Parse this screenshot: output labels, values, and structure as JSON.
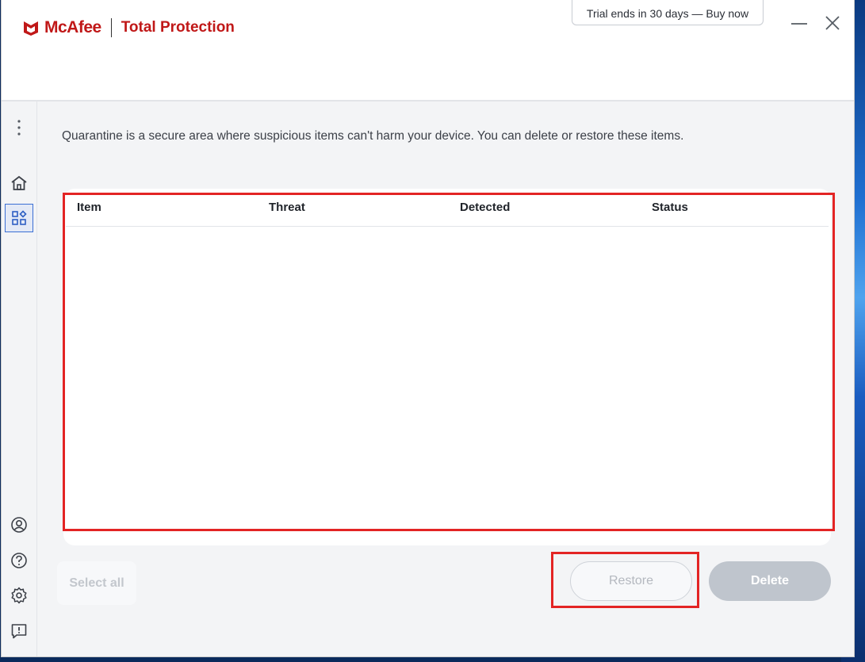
{
  "app": {
    "brand": "McAfee",
    "product": "Total Protection",
    "trial_banner": "Trial ends in 30 days — Buy now",
    "brand_color": "#c01818"
  },
  "window_controls": {
    "minimize_icon": "minimize-icon",
    "close_icon": "close-icon"
  },
  "sidebar": {
    "items": [
      {
        "name": "more-menu",
        "icon": "vertical-dots-icon"
      },
      {
        "name": "home",
        "icon": "home-icon"
      },
      {
        "name": "my-protection",
        "icon": "apps-grid-icon",
        "active": true
      },
      {
        "name": "account",
        "icon": "user-circle-icon"
      },
      {
        "name": "help",
        "icon": "question-circle-icon"
      },
      {
        "name": "settings",
        "icon": "gear-icon"
      },
      {
        "name": "feedback",
        "icon": "feedback-icon"
      }
    ]
  },
  "main": {
    "description": "Quarantine is a secure area where suspicious items can't harm your device. You can delete or restore these items.",
    "table": {
      "columns": [
        "Item",
        "Threat",
        "Detected",
        "Status"
      ],
      "rows": []
    },
    "buttons": {
      "select_all": "Select all",
      "restore": "Restore",
      "delete": "Delete"
    }
  },
  "highlight_color": "#e32424"
}
